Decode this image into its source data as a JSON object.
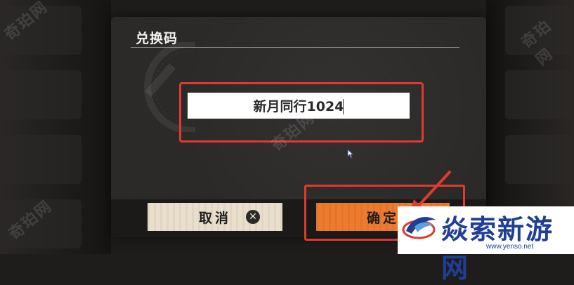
{
  "dialog": {
    "title": "兑换码",
    "code_value": "新月同行1024",
    "cancel_label": "取消",
    "confirm_label": "确定"
  },
  "watermark": {
    "text": "奇珀网"
  },
  "logo": {
    "text": "焱索新游网",
    "url": "www.yenso.net"
  },
  "colors": {
    "highlight_frame": "#e03a2f",
    "cancel_ticket": "#eadfcc",
    "confirm_ticket": "#ee7b2d",
    "logo_blue": "#1f3f96"
  },
  "icons": {
    "cancel_icon": "close-circle-icon",
    "pointer": "mouse-pointer-icon",
    "annotation": "red-arrow-icon"
  }
}
